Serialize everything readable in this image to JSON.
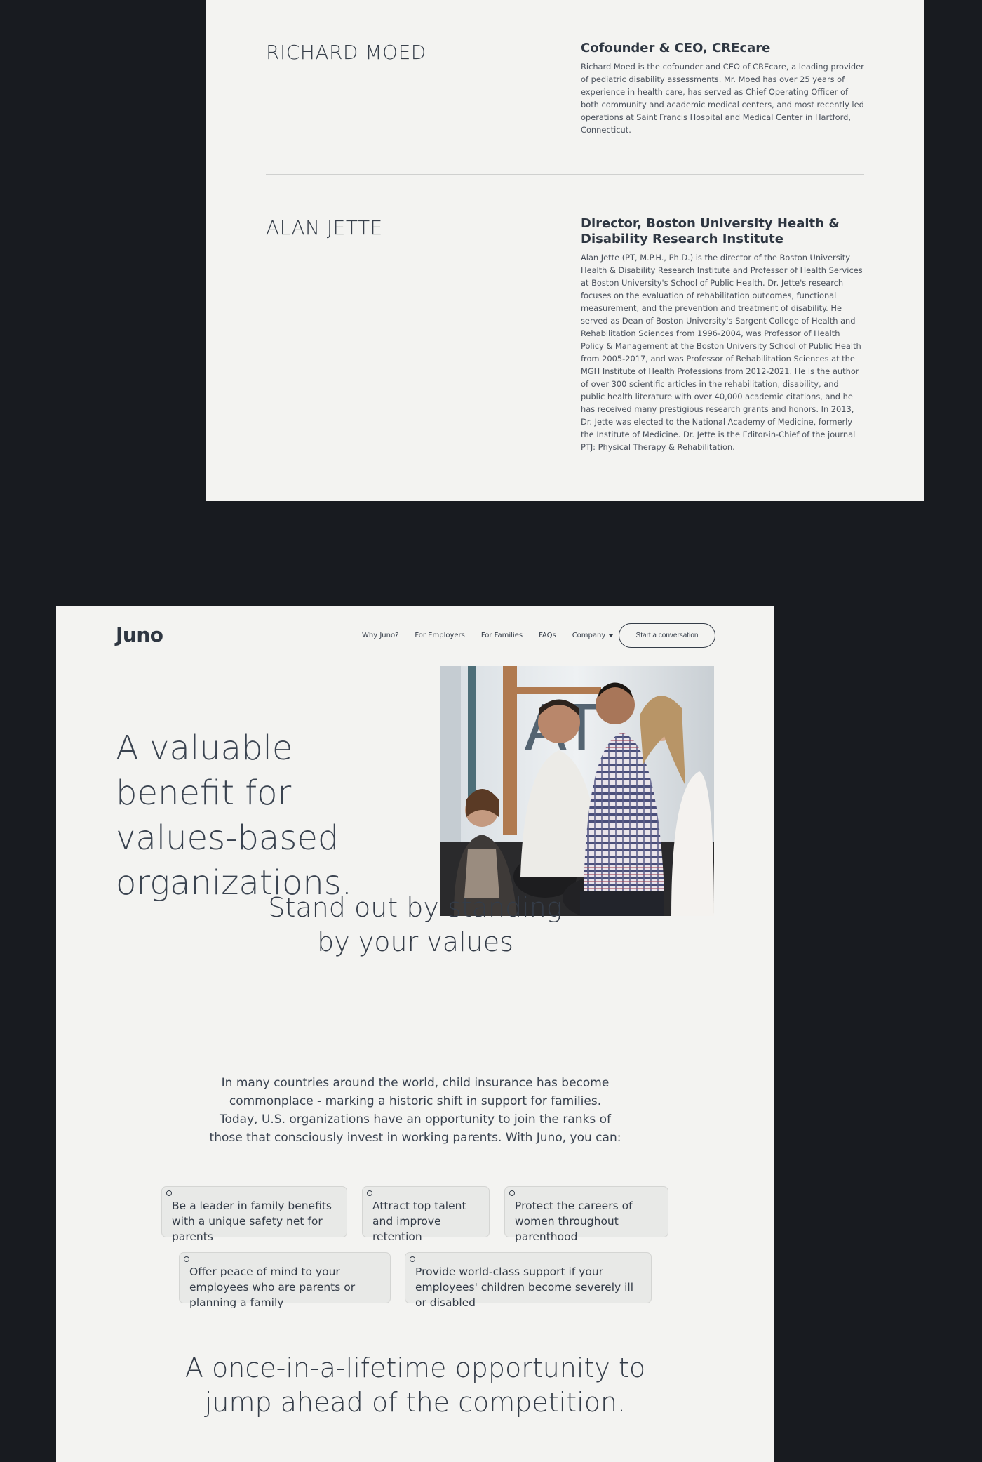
{
  "bios": [
    {
      "name": "RICHARD MOED",
      "role": "Cofounder & CEO, CREcare",
      "text": "Richard Moed is the cofounder and CEO of CREcare, a leading provider of pediatric disability assessments. Mr. Moed has over 25 years of experience in health care, has served as Chief Operating Officer of both community and academic medical centers, and most recently led operations at Saint Francis Hospital and Medical Center in Hartford, Connecticut."
    },
    {
      "name": "ALAN JETTE",
      "role": "Director, Boston University Health & Disability Research Institute",
      "text": "Alan Jette (PT, M.P.H., Ph.D.) is the director of the Boston University Health & Disability Research Institute and Professor of Health Services at Boston University's School of Public Health. Dr. Jette's research focuses on the evaluation of rehabilitation outcomes, functional measurement, and the prevention and treatment of disability.  He served as Dean of Boston University's Sargent College of Health and Rehabilitation Sciences from 1996-2004, was Professor of Health Policy & Management at the Boston University School of Public Health from 2005-2017, and was Professor of Rehabilitation Sciences at the MGH Institute of Health Professions from 2012-2021.  He is the author of over 300 scientific articles in the rehabilitation, disability, and public health literature with over 40,000 academic citations, and he has received many prestigious research grants and honors. In 2013, Dr. Jette was elected to the National Academy of Medicine, formerly the Institute of Medicine. Dr. Jette is the Editor-in-Chief of the journal PTJ: Physical Therapy & Rehabilitation."
    }
  ],
  "nav": {
    "logo": "Juno",
    "links": [
      "Why Juno?",
      "For Employers",
      "For Families",
      "FAQs"
    ],
    "company": "Company",
    "cta": "Start a conversation"
  },
  "hero": {
    "title": "A valuable benefit for values-based organizations."
  },
  "section1": {
    "title": "Stand out by standing by your values",
    "intro": "In many countries around the world, child insurance has become commonplace - marking a historic shift in support for families. Today, U.S. organizations have an opportunity to join the ranks of those that consciously invest in working parents. With Juno, you can:"
  },
  "benefits": [
    "Be a leader in family benefits with a unique safety net for parents",
    "Attract top talent and improve retention",
    "Protect the careers of women throughout parenthood",
    "Offer peace of mind to your employees who are parents or planning a family",
    "Provide world-class support if your employees' children become severely ill or disabled"
  ],
  "section2": {
    "title": "A once-in-a-lifetime opportunity to jump ahead of the competition."
  },
  "colors": {
    "page_bg": "#181b20",
    "card_bg": "#f3f3f1",
    "text": "#343c48",
    "pill_bg": "#e8e9e7"
  }
}
